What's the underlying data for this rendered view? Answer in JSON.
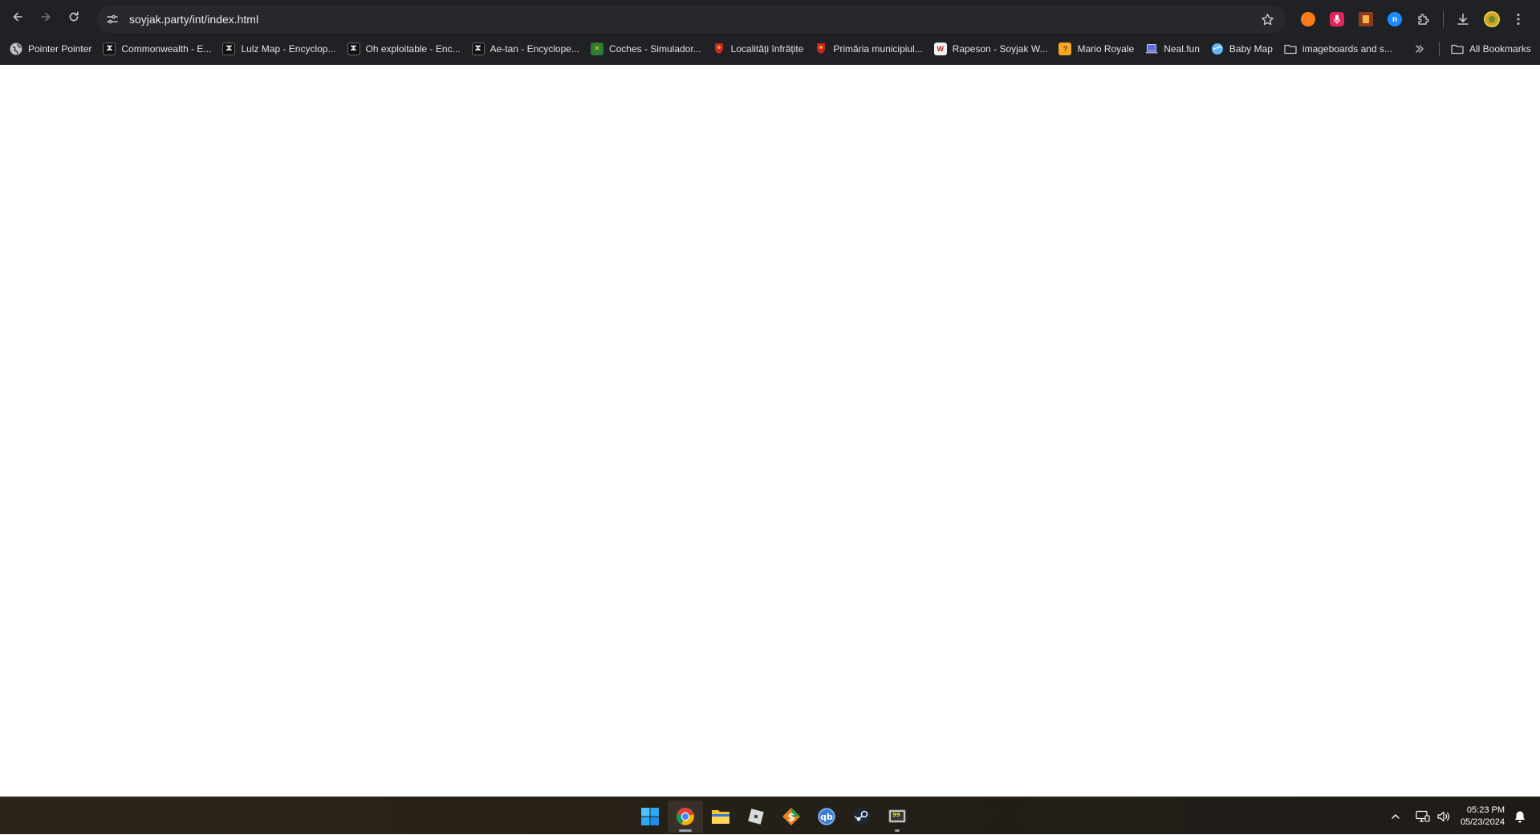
{
  "browser": {
    "url": "soyjak.party/int/index.html",
    "bookmarks": [
      {
        "label": "Pointer Pointer",
        "icon": "globe-icon"
      },
      {
        "label": "Commonwealth - E...",
        "icon": "wojak-icon"
      },
      {
        "label": "Lulz Map - Encyclop...",
        "icon": "wojak-icon"
      },
      {
        "label": "Oh exploitable - Enc...",
        "icon": "wojak-icon"
      },
      {
        "label": "Ae-tan - Encyclope...",
        "icon": "wojak-icon"
      },
      {
        "label": "Coches - Simulador...",
        "icon": "coches-icon"
      },
      {
        "label": "Localități înfrățite",
        "icon": "coat-of-arms-icon"
      },
      {
        "label": "Primăria municipiul...",
        "icon": "coat-of-arms-icon"
      },
      {
        "label": "Rapeson - Soyjak W...",
        "icon": "rapeson-icon"
      },
      {
        "label": "Mario Royale",
        "icon": "question-block-icon"
      },
      {
        "label": "Neal.fun",
        "icon": "laptop-icon"
      },
      {
        "label": "Baby Map",
        "icon": "baby-map-icon"
      },
      {
        "label": "imageboards and s...",
        "icon": "folder-icon"
      }
    ],
    "all_bookmarks_label": "All Bookmarks"
  },
  "taskbar": {
    "apps": [
      {
        "name": "start-button",
        "icon": "windows-logo-icon"
      },
      {
        "name": "taskbar-chrome",
        "icon": "chrome-icon",
        "active": true
      },
      {
        "name": "taskbar-file-explorer",
        "icon": "folder-icon"
      },
      {
        "name": "taskbar-roblox",
        "icon": "roblox-icon"
      },
      {
        "name": "taskbar-money-app",
        "icon": "dollar-icon"
      },
      {
        "name": "taskbar-qbittorrent",
        "icon": "qbittorrent-icon"
      },
      {
        "name": "taskbar-steam",
        "icon": "steam-icon"
      },
      {
        "name": "taskbar-hotline-app",
        "icon": "app-99-icon",
        "running": true
      }
    ],
    "time": "05:23 PM",
    "date": "05/23/2024"
  },
  "colors": {
    "chrome_frame": "#202124",
    "omnibox": "#28292c",
    "page_background": "#ffffff",
    "taskbar": "#241f17"
  }
}
